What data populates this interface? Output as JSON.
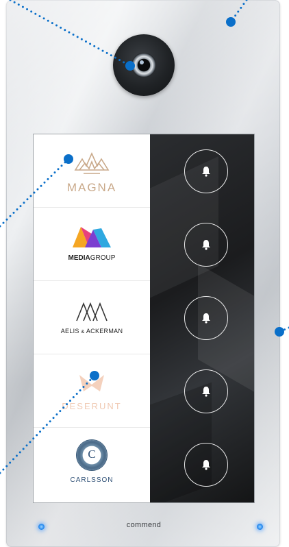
{
  "tenants": [
    {
      "name": "MAGNA",
      "color": "#c9a98a"
    },
    {
      "name_a": "MEDIA",
      "name_b": "GROUP",
      "color": "#222222"
    },
    {
      "name_a": "AELIS",
      "name_mid": "&",
      "name_b": "ACKERMAN",
      "color": "#222222"
    },
    {
      "name": "DESERUNT",
      "color": "#f0c9b2"
    },
    {
      "name": "CARLSSON",
      "monogram": "C",
      "color": "#2f5076"
    }
  ],
  "bell_icon": "bell-icon",
  "brand": "commend",
  "colors": {
    "callout": "#0a6fc9",
    "led": "#2c8df0",
    "screen_dark": "#1b1c1e"
  }
}
